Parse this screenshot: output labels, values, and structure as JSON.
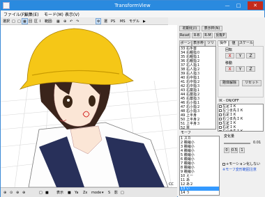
{
  "window": {
    "title": "TransformView",
    "controls": {
      "minimize": "—",
      "maximize": "□",
      "close": "✕"
    }
  },
  "menu": [
    "ファイル(F)",
    "編集(E)",
    "モード(M)",
    "表示(V)"
  ],
  "toolbar": {
    "items": [
      "選択",
      "□",
      "□",
      "▦",
      "回",
      "区",
      "Ⅰ",
      "範囲:",
      "▦",
      "⊕",
      "↶",
      "↷",
      "⚙",
      "選",
      "PS",
      "MS",
      "モデル",
      "▶"
    ]
  },
  "gizmo": {
    "items": [
      "↕",
      "↔",
      "✥",
      "✥",
      "✥",
      "✥"
    ],
    "axis_label": "X"
  },
  "bottom": {
    "items": [
      "⊕",
      "⊙",
      "⊕",
      "⊕",
      "□",
      "■",
      "表示",
      "■",
      "Ya",
      "Zx",
      "mode",
      "▾",
      "S",
      "影",
      "□"
    ],
    "corner": "CC"
  },
  "panel": {
    "top_buttons": {
      "row1": [
        "初期化(I)",
        "表示枠(N)"
      ],
      "row2": [
        "Reset",
        "R-B",
        "R-M",
        "反転P"
      ]
    },
    "tabs": [
      "ボーン",
      "表示枠",
      "ツリー",
      "操作",
      "値",
      "スケール"
    ],
    "bone_list": [
      "33  右手首",
      "34  右親指０",
      "35  右親指１",
      "36  右親指２",
      "37  右人指１",
      "38  右人指２",
      "39  右人指３",
      "40  右中指１",
      "41  右中指２",
      "42  右中指３",
      "43  右薬指１",
      "44  右薬指２",
      "45  右薬指３",
      "46  右小指１",
      "47  右小指２",
      "48  右小指３",
      "49  上半身",
      "50  上半身２",
      "51  上半身３",
      "52  首",
      "53  頭",
      "54  左目",
      "55  右目",
      "56  両目",
      "57  ヘッドセット",
      "58  全ての親",
      "59  腰",
      "60  足"
    ],
    "bone_selected_index": 21,
    "rotate": {
      "label": "回転",
      "buttons": [
        "X",
        "Y",
        "Z"
      ]
    },
    "move": {
      "label": "移動",
      "buttons": [
        "X",
        "Y",
        "Z"
      ]
    },
    "ops": [
      "剛体解除",
      "リセット"
    ],
    "ik": {
      "label": "IK - ON/OFF",
      "items": [
        "左足ＩＫ",
        "左つま先ＩＫ",
        "右足ＩＫ",
        "右つま先ＩＫ",
        "左足ＩＫ",
        "右足ＩＫ",
        "左つま先ＩＫ"
      ]
    },
    "morph": {
      "label": "モーフ",
      "items": [
        "1  スカ",
        "2  瞳縮小",
        "3  瞳縮小",
        "4  瞳縮小",
        "5  瞳縮小",
        "6  瞳縮小",
        "7  瞳縮小",
        "8  瞳縮小",
        "9  瞳縮小",
        "10  えー",
        "11  あ",
        "12  あ２",
        "13  い",
        "14  う"
      ],
      "selected_index": 12
    },
    "change": {
      "label": "変化量",
      "value": "0.01",
      "steps": [
        "0",
        "0.5",
        "1"
      ],
      "checkbox": "+モーション化しない",
      "link": "※モーフ変形範囲注意"
    }
  }
}
